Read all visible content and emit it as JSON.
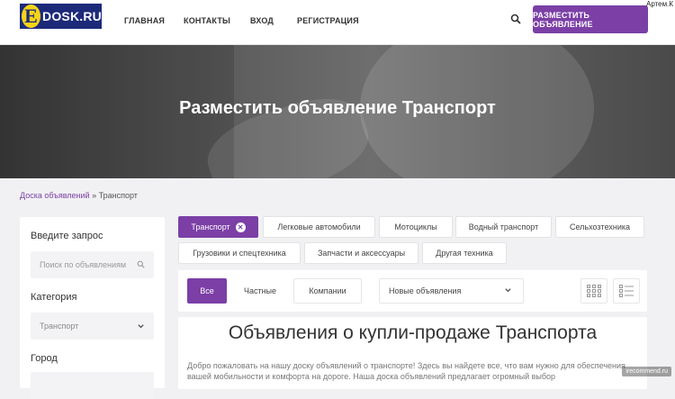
{
  "overlay": {
    "top_right_user": "Артем.К",
    "bottom_watermark": "irecommend.ru"
  },
  "header": {
    "logo_letter": "E",
    "logo_text": "DOSK.RU",
    "nav": [
      "ГЛАВНАЯ",
      "КОНТАКТЫ",
      "ВХОД",
      "РЕГИСТРАЦИЯ"
    ],
    "post_button": "РАЗМЕСТИТЬ ОБЪЯВЛЕНИЕ",
    "accent": "#7b3fa6"
  },
  "hero": {
    "title": "Разместить объявление Транспорт"
  },
  "breadcrumb": {
    "home": "Доска объявлений",
    "sep": "»",
    "current": "Транспорт"
  },
  "sidebar": {
    "query_label": "Введите запрос",
    "query_placeholder": "Поиск по объявлениям",
    "category_label": "Категория",
    "category_value": "Транспорт",
    "city_label": "Город"
  },
  "tags": [
    {
      "label": "Транспорт",
      "active": true
    },
    {
      "label": "Легковые автомобили",
      "active": false
    },
    {
      "label": "Мотоциклы",
      "active": false
    },
    {
      "label": "Водный транспорт",
      "active": false
    },
    {
      "label": "Сельхозтехника",
      "active": false
    },
    {
      "label": "Грузовики и спецтехника",
      "active": false
    },
    {
      "label": "Запчасти и аксессуары",
      "active": false
    },
    {
      "label": "Другая техника",
      "active": false
    }
  ],
  "filters": {
    "buttons": [
      "Все",
      "Частные",
      "Компании"
    ],
    "sort_value": "Новые объявления"
  },
  "content": {
    "title": "Объявления о купли-продаже Транспорта",
    "intro": "Добро пожаловать на нашу доску объявлений о транспорте! Здесь вы найдете все, что вам нужно для обеспечения вашей мобильности и комфорта на дороге. Наша доска объявлений предлагает огромный выбор"
  }
}
